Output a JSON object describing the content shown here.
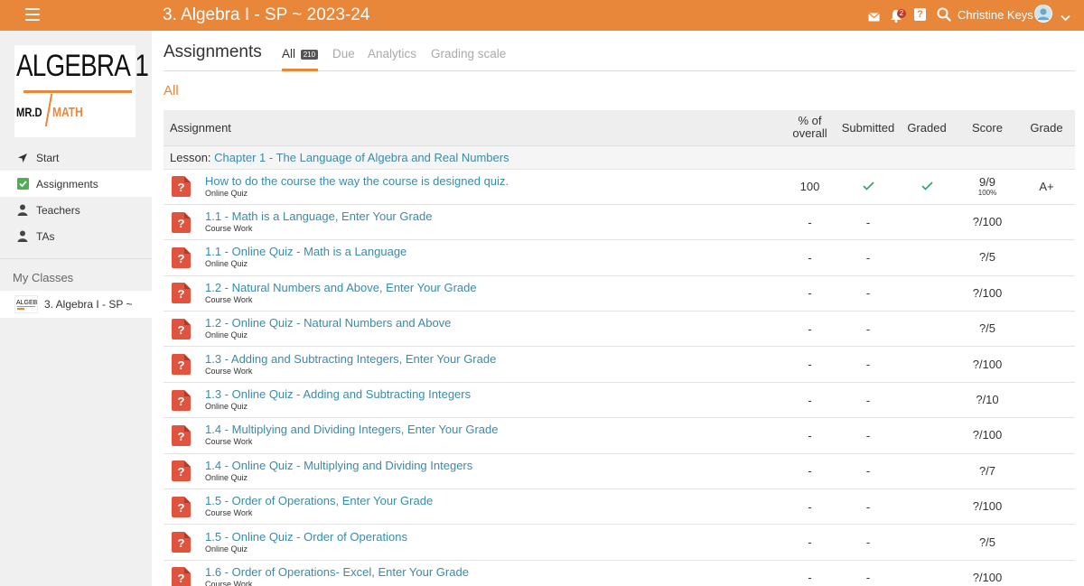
{
  "header": {
    "title": "3. Algebra I - SP ~ 2023-24",
    "notification_count": "2",
    "user_name": "Christine Keys",
    "icons": [
      "menu-icon",
      "mail-icon",
      "bell-icon",
      "help-icon",
      "search-icon",
      "avatar",
      "chevron-down-icon"
    ],
    "accent_color": "#e8863a"
  },
  "sidebar": {
    "logo": {
      "line1": "ALGEBRA 1",
      "line2": "MR.D",
      "line3": "MATH"
    },
    "items": [
      {
        "label": "Start",
        "icon": "navigation-arrow-icon"
      },
      {
        "label": "Assignments",
        "icon": "checkbox-icon"
      },
      {
        "label": "Teachers",
        "icon": "person-icon"
      },
      {
        "label": "TAs",
        "icon": "person-icon"
      }
    ],
    "my_classes_label": "My Classes",
    "classes": [
      {
        "label": "3. Algebra I - SP ~"
      }
    ]
  },
  "main": {
    "heading": "Assignments",
    "tabs": [
      {
        "label": "All",
        "count": "210"
      },
      {
        "label": "Due"
      },
      {
        "label": "Analytics"
      },
      {
        "label": "Grading scale"
      }
    ],
    "section_title": "All",
    "table": {
      "headers": {
        "assignment": "Assignment",
        "percent_line1": "% of",
        "percent_line2": "overall",
        "submitted": "Submitted",
        "graded": "Graded",
        "score": "Score",
        "grade": "Grade"
      },
      "lesson_prefix": "Lesson:",
      "lesson_name": "Chapter 1 - The Language of Algebra and Real Numbers",
      "rows": [
        {
          "title": "How to do the course the way the course is designed quiz.",
          "type": "Online Quiz",
          "percent": "100",
          "submitted": "✓",
          "graded": "✓",
          "score": "9/9",
          "score_pct": "100%",
          "grade": "A+"
        },
        {
          "title": "1.1 - Math is a Language, Enter Your Grade",
          "type": "Course Work",
          "percent": "-",
          "submitted": "-",
          "graded": "",
          "score": "?/100",
          "score_pct": "",
          "grade": ""
        },
        {
          "title": "1.1 - Online Quiz - Math is a Language",
          "type": "Online Quiz",
          "percent": "-",
          "submitted": "-",
          "graded": "",
          "score": "?/5",
          "score_pct": "",
          "grade": ""
        },
        {
          "title": "1.2 - Natural Numbers and Above, Enter Your Grade",
          "type": "Course Work",
          "percent": "-",
          "submitted": "-",
          "graded": "",
          "score": "?/100",
          "score_pct": "",
          "grade": ""
        },
        {
          "title": "1.2 - Online Quiz - Natural Numbers and Above",
          "type": "Online Quiz",
          "percent": "-",
          "submitted": "-",
          "graded": "",
          "score": "?/5",
          "score_pct": "",
          "grade": ""
        },
        {
          "title": "1.3 - Adding and Subtracting Integers, Enter Your Grade",
          "type": "Course Work",
          "percent": "-",
          "submitted": "-",
          "graded": "",
          "score": "?/100",
          "score_pct": "",
          "grade": ""
        },
        {
          "title": "1.3 - Online Quiz - Adding and Subtracting Integers",
          "type": "Online Quiz",
          "percent": "-",
          "submitted": "-",
          "graded": "",
          "score": "?/10",
          "score_pct": "",
          "grade": ""
        },
        {
          "title": "1.4 - Multiplying and Dividing Integers, Enter Your Grade",
          "type": "Course Work",
          "percent": "-",
          "submitted": "-",
          "graded": "",
          "score": "?/100",
          "score_pct": "",
          "grade": ""
        },
        {
          "title": "1.4 - Online Quiz - Multiplying and Dividing Integers",
          "type": "Online Quiz",
          "percent": "-",
          "submitted": "-",
          "graded": "",
          "score": "?/7",
          "score_pct": "",
          "grade": ""
        },
        {
          "title": "1.5 - Order of Operations, Enter Your Grade",
          "type": "Course Work",
          "percent": "-",
          "submitted": "-",
          "graded": "",
          "score": "?/100",
          "score_pct": "",
          "grade": ""
        },
        {
          "title": "1.5 - Online Quiz - Order of Operations",
          "type": "Online Quiz",
          "percent": "-",
          "submitted": "-",
          "graded": "",
          "score": "?/5",
          "score_pct": "",
          "grade": ""
        },
        {
          "title": "1.6 - Order of Operations- Excel, Enter Your Grade",
          "type": "Course Work",
          "percent": "-",
          "submitted": "-",
          "graded": "",
          "score": "?/100",
          "score_pct": "",
          "grade": ""
        }
      ]
    }
  }
}
